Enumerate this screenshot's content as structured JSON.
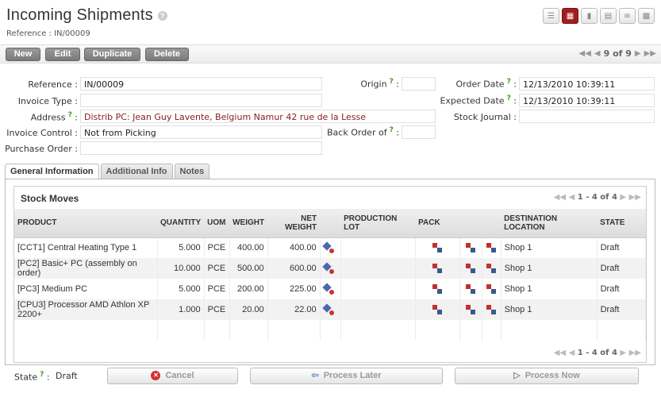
{
  "header": {
    "title": "Incoming Shipments",
    "help": "?",
    "reference": "Reference : IN/00009"
  },
  "toolbar": {
    "new": "New",
    "edit": "Edit",
    "duplicate": "Duplicate",
    "delete": "Delete",
    "pager": "9 of 9"
  },
  "form": {
    "reference_label": "Reference :",
    "reference": "IN/00009",
    "invoice_type_label": "Invoice Type :",
    "invoice_type": "",
    "address_label": "Address",
    "address": "Distrib PC: Jean Guy Lavente, Belgium Namur 42 rue de la Lesse",
    "invoice_control_label": "Invoice Control :",
    "invoice_control": "Not from Picking",
    "purchase_order_label": "Purchase Order :",
    "purchase_order": "",
    "origin_label": "Origin",
    "origin": "",
    "back_order_label": "Back Order of",
    "back_order": "",
    "order_date_label": "Order Date",
    "order_date": "12/13/2010 10:39:11",
    "expected_date_label": "Expected Date",
    "expected_date": "12/13/2010 10:39:11",
    "stock_journal_label": "Stock Journal :",
    "stock_journal": ""
  },
  "tabs": [
    "General Information",
    "Additional Info",
    "Notes"
  ],
  "stock_moves": {
    "title": "Stock Moves",
    "pager": "1 - 4 of 4",
    "columns": {
      "product": "PRODUCT",
      "quantity": "QUANTITY",
      "uom": "UOM",
      "weight": "WEIGHT",
      "net1": "NET",
      "net2": "WEIGHT",
      "lot1": "PRODUCTION",
      "lot2": "LOT",
      "pack": "PACK",
      "dest1": "DESTINATION",
      "dest2": "LOCATION",
      "state": "STATE"
    },
    "rows": [
      {
        "product": "[CCT1] Central Heating Type 1",
        "quantity": "5.000",
        "uom": "PCE",
        "weight": "400.00",
        "net_weight": "400.00",
        "location": "Shop 1",
        "state": "Draft"
      },
      {
        "product": "[PC2] Basic+ PC (assembly on order)",
        "quantity": "10.000",
        "uom": "PCE",
        "weight": "500.00",
        "net_weight": "600.00",
        "location": "Shop 1",
        "state": "Draft"
      },
      {
        "product": "[PC3] Medium PC",
        "quantity": "5.000",
        "uom": "PCE",
        "weight": "200.00",
        "net_weight": "225.00",
        "location": "Shop 1",
        "state": "Draft"
      },
      {
        "product": "[CPU3] Processor AMD Athlon XP 2200+",
        "quantity": "1.000",
        "uom": "PCE",
        "weight": "20.00",
        "net_weight": "22.00",
        "location": "Shop 1",
        "state": "Draft"
      }
    ]
  },
  "footer": {
    "state_label": "State",
    "state": "Draft",
    "cancel": "Cancel",
    "process_later": "Process Later",
    "process_now": "Process Now"
  }
}
